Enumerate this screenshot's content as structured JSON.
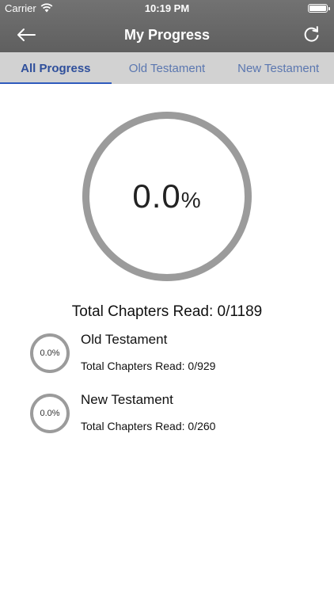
{
  "status_bar": {
    "carrier": "Carrier",
    "time": "10:19 PM"
  },
  "nav": {
    "title": "My Progress",
    "back_icon": "back-arrow-icon",
    "refresh_icon": "refresh-icon"
  },
  "tabs": [
    {
      "label": "All Progress",
      "active": true
    },
    {
      "label": "Old Testament",
      "active": false
    },
    {
      "label": "New Testament",
      "active": false
    }
  ],
  "overall": {
    "percent": "0.0",
    "percent_sign": "%",
    "total_label": "Total Chapters Read: 0/1189"
  },
  "sections": [
    {
      "name": "Old Testament",
      "percent": "0.0%",
      "total_label": "Total Chapters Read: 0/929"
    },
    {
      "name": "New Testament",
      "percent": "0.0%",
      "total_label": "Total Chapters Read: 0/260"
    }
  ],
  "colors": {
    "header": "#686868",
    "tab_bar": "#d2d2d2",
    "tab_active": "#2f4f9b",
    "tab_inactive": "#5b77b0",
    "ring": "#9b9b9b"
  }
}
